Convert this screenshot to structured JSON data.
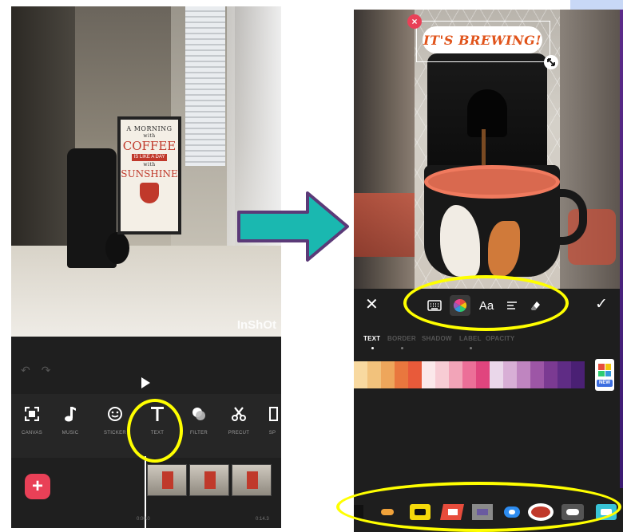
{
  "left_phone": {
    "sign": {
      "line1": "A MORNING",
      "line2": "with",
      "line3": "COFFEE",
      "line4": "IS LIKE A DAY",
      "line5": "with",
      "line6": "SUNSHINE"
    },
    "watermark": "InShOt",
    "toolbar": [
      {
        "label": "CANVAS",
        "icon": "canvas-icon"
      },
      {
        "label": "MUSIC",
        "icon": "music-note-icon"
      },
      {
        "label": "STICKER",
        "icon": "smiley-icon"
      },
      {
        "label": "TEXT",
        "icon": "text-t-icon"
      },
      {
        "label": "FILTER",
        "icon": "filter-icon"
      },
      {
        "label": "PRECUT",
        "icon": "scissors-icon"
      },
      {
        "label": "SP",
        "icon": "split-icon"
      }
    ],
    "add_button": "+",
    "time_start": "0:00.0",
    "time_end": "0:14.3"
  },
  "right_phone": {
    "sticker_text": "IT'S BREWING!",
    "sticker_close": "×",
    "toolbar": {
      "close": "✕",
      "confirm": "✓",
      "font_label": "Aa",
      "tools": [
        "keyboard-icon",
        "color-wheel-icon",
        "font-icon",
        "align-icon",
        "eraser-icon"
      ]
    },
    "sub_tabs": [
      "TEXT",
      "BORDER",
      "SHADOW",
      "LABEL",
      "OPACITY"
    ],
    "active_sub_tab": "TEXT",
    "palette": [
      "#f8d9a0",
      "#f2c27c",
      "#eea65b",
      "#e9773e",
      "#e85a3a",
      "#fbe8ea",
      "#f7ccd4",
      "#f2a4b8",
      "#ec6f98",
      "#e0457e",
      "#ead7ea",
      "#d8afd6",
      "#bf85c0",
      "#9d56a6",
      "#7b3a92",
      "#5f2c85",
      "#4a2074"
    ],
    "new_badge": "NEW"
  },
  "colors": {
    "highlight": "#ffff00",
    "arrow_fill": "#1ab8b0",
    "arrow_stroke": "#5b3a78",
    "add_button": "#e94057",
    "sticker_text": "#e0531a"
  }
}
